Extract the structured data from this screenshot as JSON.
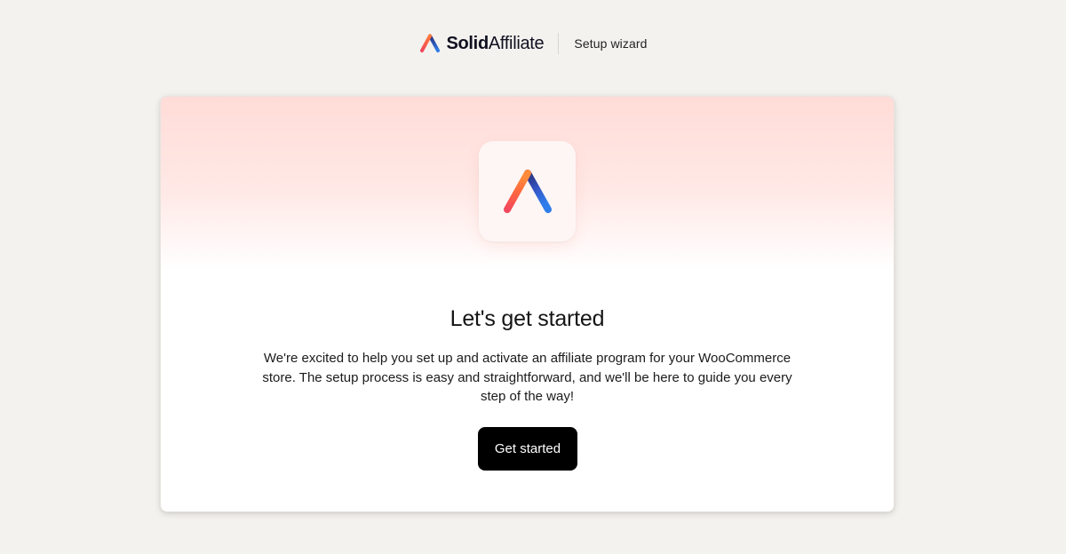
{
  "header": {
    "brand_strong": "Solid",
    "brand_light": "Affiliate",
    "subtitle": "Setup wizard",
    "logo_icon": "solid-affiliate-triangle-logo"
  },
  "card": {
    "hero_icon": "solid-affiliate-triangle-logo",
    "title": "Let's get started",
    "description": "We're excited to help you set up and activate an affiliate program for your WooCommerce store. The setup process is easy and straightforward, and we'll be here to guide you every step of the way!",
    "cta_label": "Get started"
  },
  "colors": {
    "page_background": "#f3f2ee",
    "hero_gradient_top": "#ffdcd8",
    "button_background": "#000000",
    "button_text": "#ffffff",
    "logo_red": "#f2475c",
    "logo_orange": "#ffa63d",
    "logo_yellow": "#ffd04a",
    "logo_blue": "#2f7dea",
    "logo_indigo": "#2b2d7a"
  }
}
